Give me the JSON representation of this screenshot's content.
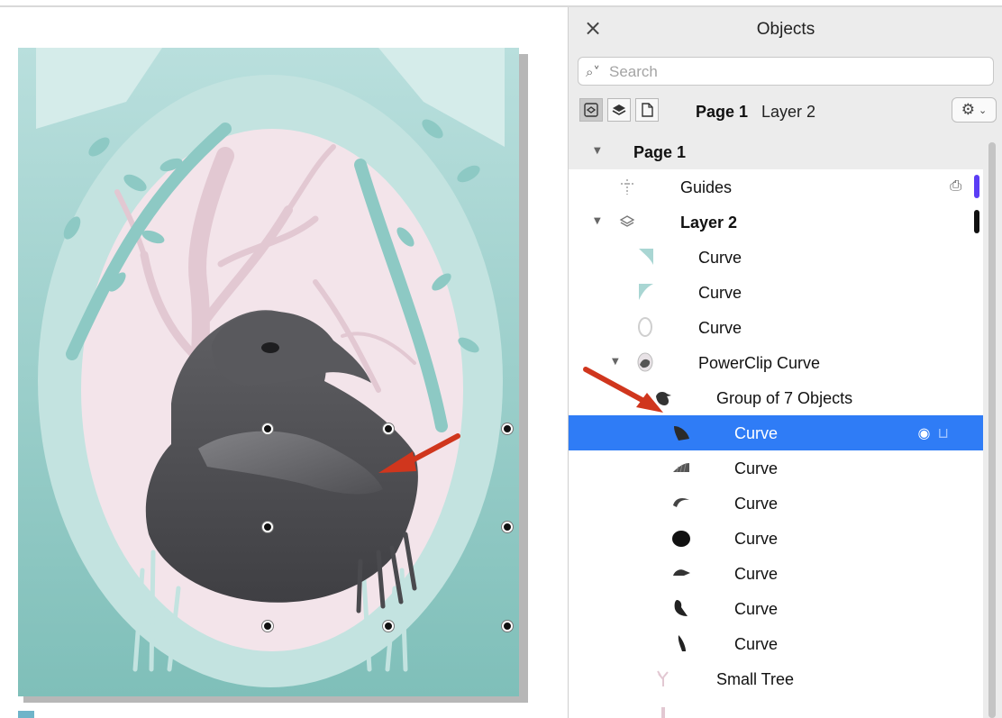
{
  "panel": {
    "title": "Objects",
    "search_placeholder": "Search",
    "breadcrumb": {
      "page": "Page 1",
      "layer": "Layer 2"
    }
  },
  "tree": {
    "page": "Page 1",
    "guides": "Guides",
    "layer": "Layer 2",
    "items": [
      {
        "label": "Curve"
      },
      {
        "label": "Curve"
      },
      {
        "label": "Curve"
      },
      {
        "label": "PowerClip Curve"
      },
      {
        "label": "Group of 7 Objects"
      },
      {
        "label": "Curve"
      },
      {
        "label": "Curve"
      },
      {
        "label": "Curve"
      },
      {
        "label": "Curve"
      },
      {
        "label": "Curve"
      },
      {
        "label": "Curve"
      },
      {
        "label": "Curve"
      },
      {
        "label": "Small Tree"
      }
    ]
  },
  "colors": {
    "selection": "#2f7cf6",
    "guides_marker": "#5b3df5",
    "teal": "#a9d6d3",
    "pink": "#f3e4ea",
    "raven": "#555558",
    "arrow": "#d0361d"
  }
}
